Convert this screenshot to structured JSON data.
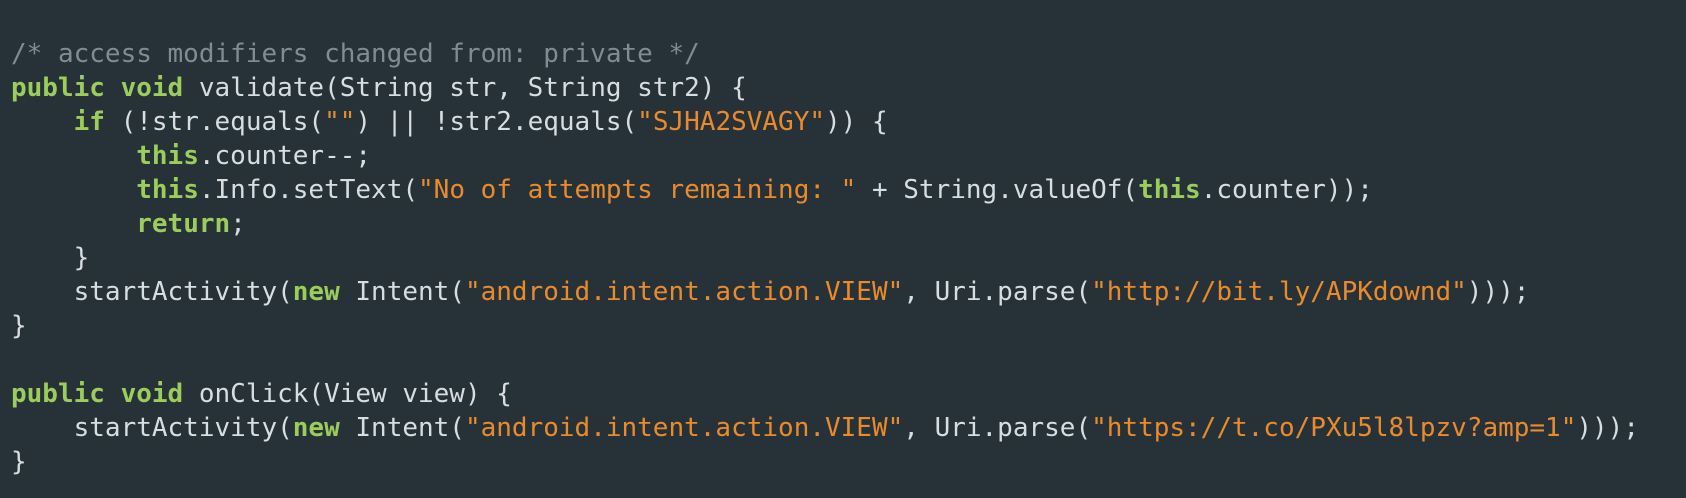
{
  "code": {
    "lines": [
      [
        {
          "t": "/* access modifiers changed from: private */",
          "k": "comment"
        }
      ],
      [
        {
          "t": "public",
          "k": "kw"
        },
        {
          "t": " ",
          "k": "plain"
        },
        {
          "t": "void",
          "k": "kw"
        },
        {
          "t": " validate(String str, String str2) {",
          "k": "plain"
        }
      ],
      [
        {
          "t": "    ",
          "k": "plain"
        },
        {
          "t": "if",
          "k": "kw"
        },
        {
          "t": " (!str.equals(",
          "k": "plain"
        },
        {
          "t": "\"\"",
          "k": "str"
        },
        {
          "t": ") || !str2.equals(",
          "k": "plain"
        },
        {
          "t": "\"SJHA2SVAGY\"",
          "k": "str"
        },
        {
          "t": ")) {",
          "k": "plain"
        }
      ],
      [
        {
          "t": "        ",
          "k": "plain"
        },
        {
          "t": "this",
          "k": "kw"
        },
        {
          "t": ".counter--;",
          "k": "plain"
        }
      ],
      [
        {
          "t": "        ",
          "k": "plain"
        },
        {
          "t": "this",
          "k": "kw"
        },
        {
          "t": ".Info.setText(",
          "k": "plain"
        },
        {
          "t": "\"No of attempts remaining: \"",
          "k": "str"
        },
        {
          "t": " + String.valueOf(",
          "k": "plain"
        },
        {
          "t": "this",
          "k": "kw"
        },
        {
          "t": ".counter));",
          "k": "plain"
        }
      ],
      [
        {
          "t": "        ",
          "k": "plain"
        },
        {
          "t": "return",
          "k": "kw"
        },
        {
          "t": ";",
          "k": "plain"
        }
      ],
      [
        {
          "t": "    }",
          "k": "plain"
        }
      ],
      [
        {
          "t": "    startActivity(",
          "k": "plain"
        },
        {
          "t": "new",
          "k": "kw"
        },
        {
          "t": " Intent(",
          "k": "plain"
        },
        {
          "t": "\"android.intent.action.VIEW\"",
          "k": "str"
        },
        {
          "t": ", Uri.parse(",
          "k": "plain"
        },
        {
          "t": "\"http://bit.ly/APKdownd\"",
          "k": "str"
        },
        {
          "t": ")));",
          "k": "plain"
        }
      ],
      [
        {
          "t": "}",
          "k": "plain"
        }
      ],
      [
        {
          "t": "",
          "k": "plain"
        }
      ],
      [
        {
          "t": "public",
          "k": "kw"
        },
        {
          "t": " ",
          "k": "plain"
        },
        {
          "t": "void",
          "k": "kw"
        },
        {
          "t": " onClick(View view) {",
          "k": "plain"
        }
      ],
      [
        {
          "t": "    startActivity(",
          "k": "plain"
        },
        {
          "t": "new",
          "k": "kw"
        },
        {
          "t": " Intent(",
          "k": "plain"
        },
        {
          "t": "\"android.intent.action.VIEW\"",
          "k": "str"
        },
        {
          "t": ", Uri.parse(",
          "k": "plain"
        },
        {
          "t": "\"https://t.co/PXu5l8lpzv?amp=1\"",
          "k": "str"
        },
        {
          "t": ")));",
          "k": "plain"
        }
      ],
      [
        {
          "t": "}",
          "k": "plain"
        }
      ]
    ]
  },
  "colors": {
    "background": "#263238",
    "keyword": "#9bcc5c",
    "string": "#e98b2d",
    "comment": "#7f8c92",
    "plain": "#d7dde0"
  }
}
